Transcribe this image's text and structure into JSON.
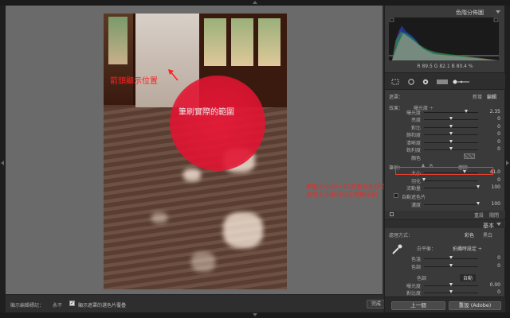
{
  "overlay": {
    "brush_label": "筆刷實際的範圍",
    "arrow_label": "箭頭顯示位置",
    "side_note_line1": "筆刷大小24~41就會有此移位",
    "side_note_line2": "其他大小是可以正常顯示的"
  },
  "toolbar": {
    "overlay_label": "顯示編輯標記：",
    "overlay_value": "永不",
    "checkbox_checked": true,
    "checkbox_label": "顯示遮罩的選色片覆疊",
    "done_label": "完成"
  },
  "panel": {
    "histogram_title": "色階分佈圖",
    "readout": {
      "r_label": "R",
      "r": "89.5",
      "g_label": "G",
      "g": "82.1",
      "b_label": "B",
      "b": "80.4",
      "unit": "%"
    },
    "mask_label": "遮罩：",
    "mask_new": "新增",
    "mask_edit": "編輯",
    "effect_label": "效果：",
    "effect_value": "曝光度 ÷",
    "sliders": [
      {
        "label": "曝光度",
        "value": "2.35",
        "pos": 0.78
      },
      {
        "label": "亮度",
        "value": "0",
        "pos": 0.5
      },
      {
        "label": "對比",
        "value": "0",
        "pos": 0.5
      },
      {
        "label": "飽和度",
        "value": "0",
        "pos": 0.5
      },
      {
        "label": "清晰度",
        "value": "0",
        "pos": 0.5
      },
      {
        "label": "銳利度",
        "value": "0",
        "pos": 0.5
      }
    ],
    "color_label": "顏色",
    "brush_label": "筆刷：",
    "brush_a": "A",
    "brush_b": "B",
    "brush_erase": "擦除",
    "brush_sliders": [
      {
        "label": "大小",
        "value": "41.0",
        "pos": 0.75
      },
      {
        "label": "羽化",
        "value": "0",
        "pos": 0.0
      },
      {
        "label": "流動量",
        "value": "100",
        "pos": 1.0
      }
    ],
    "automask_label": "自動遮色片",
    "density": {
      "label": "濃度",
      "value": "100",
      "pos": 1.0
    },
    "reset_label": "重設",
    "close_label": "關閉",
    "basic_title": "基本",
    "process_label": "處理方式：",
    "process_color": "彩色",
    "process_bw": "黑白",
    "wb_label": "白平衡：",
    "wb_value": "拍攝時設定 ÷",
    "temp": {
      "label": "色溫",
      "value": "0",
      "pos": 0.5
    },
    "tint": {
      "label": "色調",
      "value": "0",
      "pos": 0.5
    },
    "tone_label": "色調",
    "tone_auto": "自動",
    "exposure": {
      "label": "曝光度",
      "value": "0.00",
      "pos": 0.5
    },
    "contrast": {
      "label": "對比度",
      "value": "0",
      "pos": 0.5
    },
    "prev_button": "上一個",
    "reset_adobe_button": "重設 (Adobe)"
  },
  "colors": {
    "accent_red": "#e04030",
    "brush_red": "#e81a3a"
  }
}
